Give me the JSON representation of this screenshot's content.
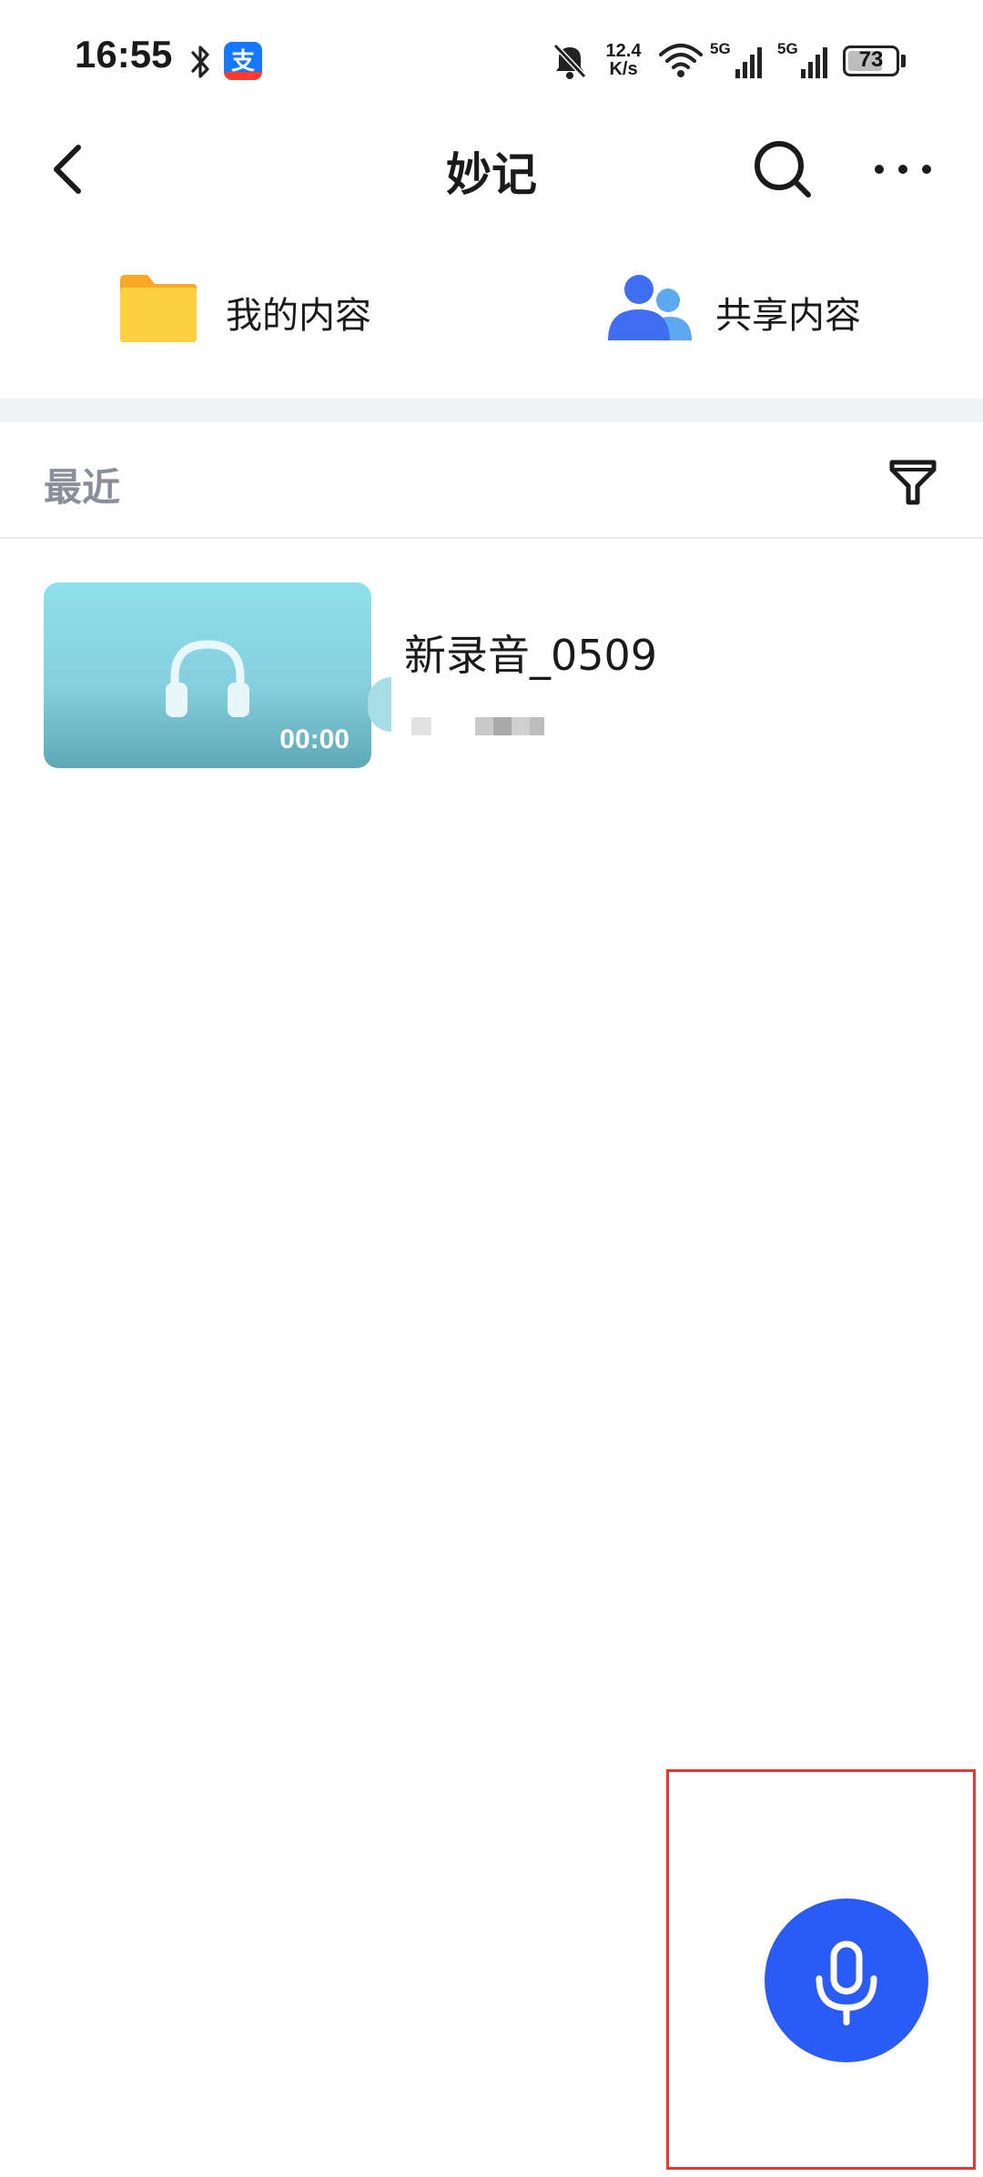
{
  "status_bar": {
    "time": "16:55",
    "net_speed_value": "12.4",
    "net_speed_unit": "K/s",
    "signal1_label": "5G",
    "signal2_label": "5G",
    "battery": "73",
    "battery_level": 0.73,
    "alipay_glyph": "支"
  },
  "header": {
    "title": "妙记"
  },
  "categories": [
    {
      "label": "我的内容",
      "icon": "folder-icon"
    },
    {
      "label": "共享内容",
      "icon": "people-icon"
    }
  ],
  "recent": {
    "title": "最近"
  },
  "recordings": [
    {
      "title": "新录音_0509",
      "duration": "00:00",
      "thumbnail_icon": "headphones-icon"
    }
  ],
  "fab": {
    "icon": "microphone-icon",
    "color": "#2a5cf5"
  },
  "colors": {
    "accent": "#2a5cf5",
    "folder": "#fbc02d",
    "people": "#3f6ef2",
    "muted_text": "#8a8e99",
    "highlight_box": "#e53935"
  }
}
